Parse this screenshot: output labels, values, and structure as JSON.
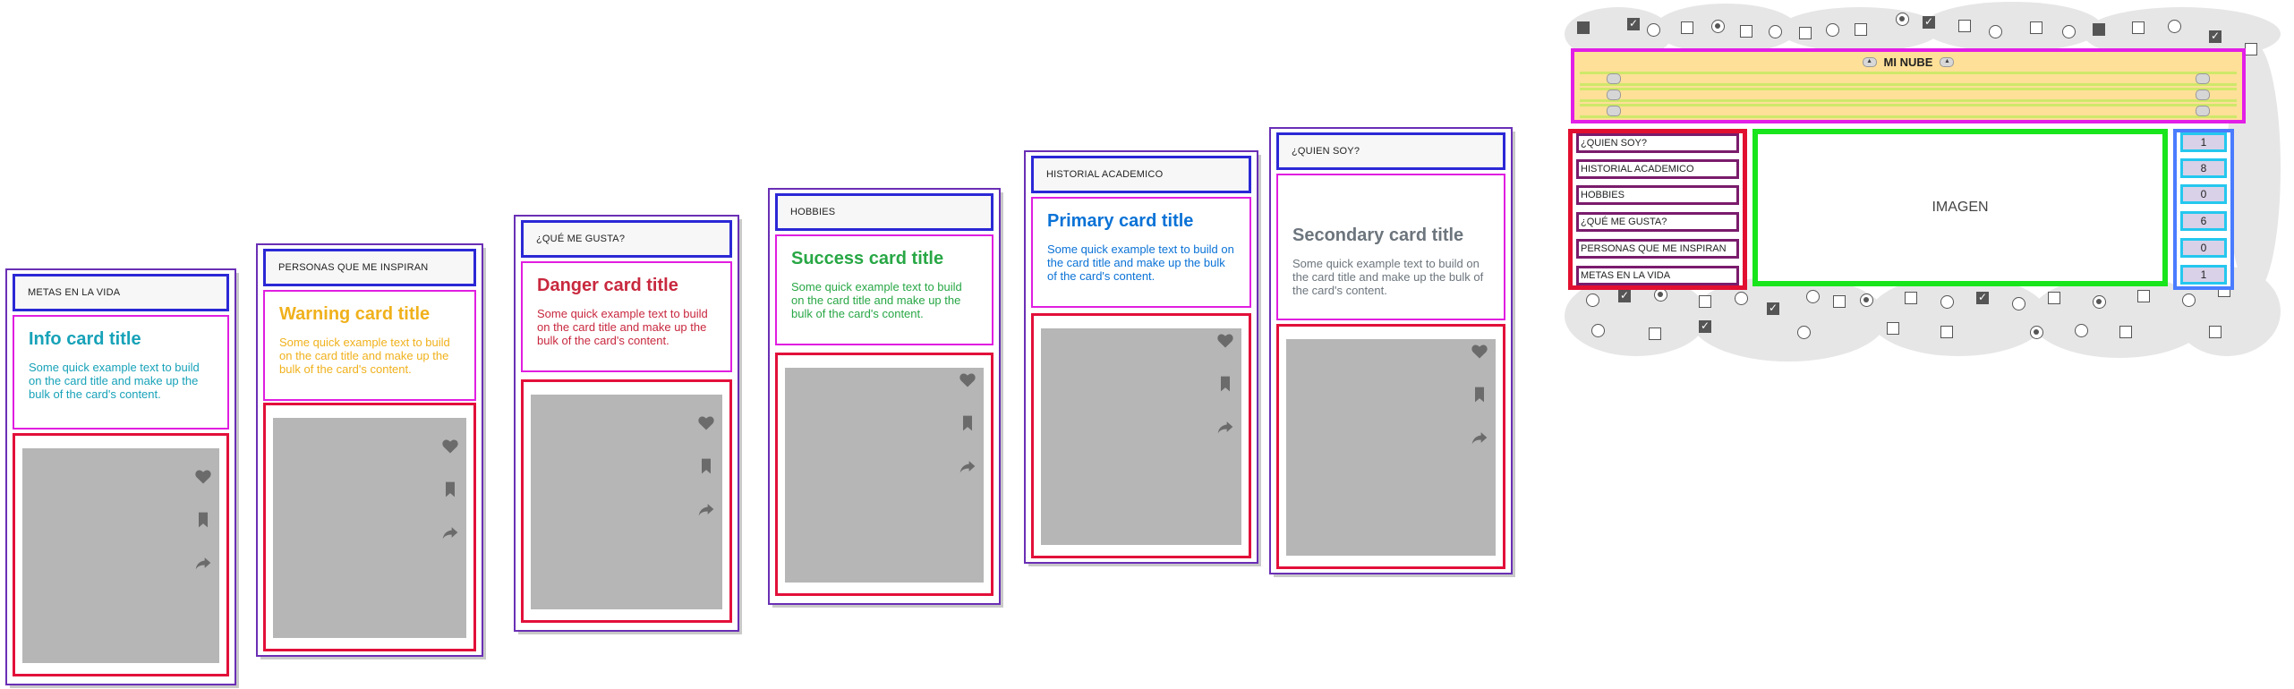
{
  "cards": [
    {
      "id": "metas",
      "header": "METAS EN LA VIDA",
      "title": "Info card title",
      "text": "Some quick example text to build on the card title and make up the bulk of the card's content.",
      "color": "#17a2b8"
    },
    {
      "id": "personas",
      "header": "PERSONAS QUE ME INSPIRAN",
      "title": "Warning card title",
      "text": "Some quick example text to build on the card title and make up the bulk of the card's content.",
      "color": "#f0b11c"
    },
    {
      "id": "gusta",
      "header": "¿QUÉ ME GUSTA?",
      "title": "Danger card title",
      "text": "Some quick example text to build on the card title and make up the bulk of the card's content.",
      "color": "#c8283e"
    },
    {
      "id": "hobbies",
      "header": "HOBBIES",
      "title": "Success card title",
      "text": "Some quick example text to build on the card title and make up the bulk of the card's content.",
      "color": "#28a745"
    },
    {
      "id": "historial",
      "header": "HISTORIAL ACADEMICO",
      "title": "Primary card title",
      "text": "Some quick example text to build on the card title and make up the bulk of the card's content.",
      "color": "#0a72d6"
    },
    {
      "id": "quien",
      "header": "¿QUIEN SOY?",
      "title": "Secondary card title",
      "text": "Some quick example text to build on the card title and make up the bulk of the card's content.",
      "color": "#6c757d"
    }
  ],
  "icons": [
    "heart-icon",
    "bookmark-icon",
    "share-icon"
  ],
  "mi_nube": {
    "title": "MI NUBE",
    "menu": [
      "¿QUIEN SOY?",
      "HISTORIAL ACADEMICO",
      "HOBBIES",
      "¿QUÉ ME GUSTA?",
      "PERSONAS QUE ME INSPIRAN",
      "METAS EN LA VIDA"
    ],
    "counts": [
      "1",
      "8",
      "0",
      "6",
      "0",
      "1"
    ],
    "image_label": "IMAGEN"
  }
}
